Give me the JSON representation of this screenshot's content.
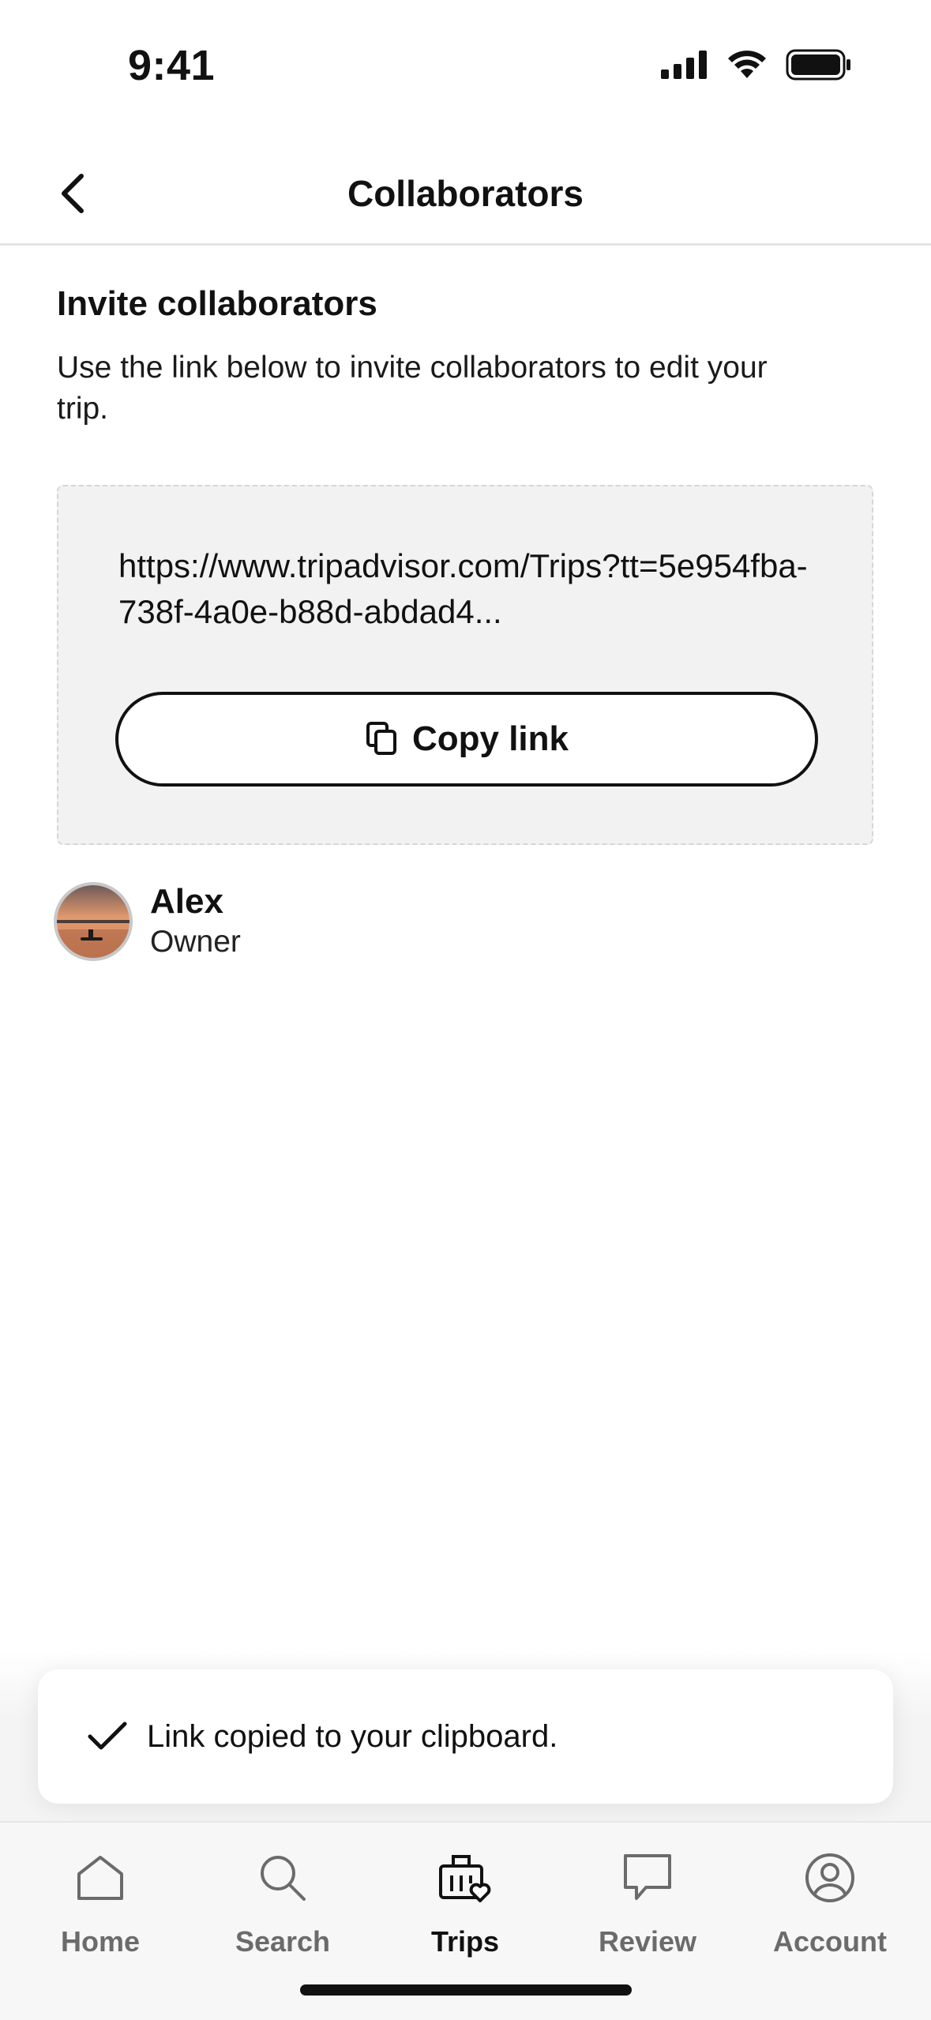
{
  "status_bar": {
    "time": "9:41"
  },
  "header": {
    "title": "Collaborators",
    "back_icon": "chevron-left-icon"
  },
  "invite": {
    "title": "Invite collaborators",
    "description": "Use the link below to invite collaborators to edit your trip.",
    "link_text": "https://www.tripadvisor.com/Trips?tt=5e954fba-738f-4a0e-b88d-abdad4...",
    "copy_button_label": "Copy link"
  },
  "collaborators": [
    {
      "name": "Alex",
      "role": "Owner"
    }
  ],
  "toast": {
    "message": "Link copied to your clipboard."
  },
  "tab_bar": {
    "items": [
      {
        "label": "Home",
        "icon": "home-icon",
        "active": false
      },
      {
        "label": "Search",
        "icon": "search-icon",
        "active": false
      },
      {
        "label": "Trips",
        "icon": "trips-icon",
        "active": true
      },
      {
        "label": "Review",
        "icon": "review-icon",
        "active": false
      },
      {
        "label": "Account",
        "icon": "account-icon",
        "active": false
      }
    ]
  },
  "colors": {
    "text": "#111111",
    "inactive_tab": "#6b6b6b",
    "link_box_bg": "#f2f2f2"
  }
}
